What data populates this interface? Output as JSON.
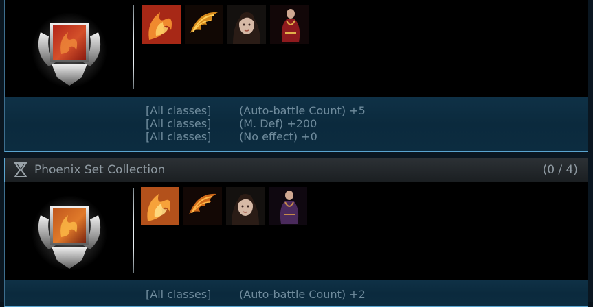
{
  "collections": [
    {
      "items": [
        {
          "name": "phoenix-flame-armor-item",
          "icon": "flame-bird-icon"
        },
        {
          "name": "golden-wing-item",
          "icon": "wing-icon"
        },
        {
          "name": "costume-portrait-item",
          "icon": "character-portrait-icon"
        },
        {
          "name": "red-robe-costume-item",
          "icon": "robe-icon"
        }
      ],
      "bonuses": [
        {
          "class_label": "[All classes]",
          "effect": "(Auto-battle Count) +5"
        },
        {
          "class_label": "[All classes]",
          "effect": "(M. Def) +200"
        },
        {
          "class_label": "[All classes]",
          "effect": "(No effect) +0"
        }
      ]
    },
    {
      "title": "Phoenix Set Collection",
      "progress": "(0 / 4)",
      "items": [
        {
          "name": "phoenix-flame-armor-item",
          "icon": "flame-bird-icon"
        },
        {
          "name": "golden-wing-item",
          "icon": "wing-icon"
        },
        {
          "name": "costume-portrait-item",
          "icon": "character-portrait-icon"
        },
        {
          "name": "purple-robe-costume-item",
          "icon": "robe-icon"
        }
      ],
      "bonuses": [
        {
          "class_label": "[All classes]",
          "effect": "(Auto-battle Count) +2"
        }
      ]
    }
  ],
  "colors": {
    "panel_border": "#5aa4cf",
    "bonus_text": "#6f8b9c",
    "header_text": "#8f9aa2"
  }
}
